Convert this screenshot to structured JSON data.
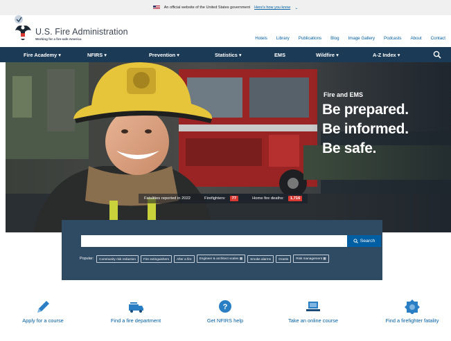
{
  "gov_banner": {
    "text": "An official website of the United States government",
    "link": "Here's how you know"
  },
  "header": {
    "title": "U.S. Fire Administration",
    "tagline": "Working for a fire-safe America",
    "utility_nav": [
      "Hotels",
      "Library",
      "Publications",
      "Blog",
      "Image Gallery",
      "Podcasts",
      "About",
      "Contact"
    ]
  },
  "main_nav": {
    "items": [
      {
        "label": "Fire Academy ▾"
      },
      {
        "label": "NFIRS ▾"
      },
      {
        "label": "Prevention ▾"
      },
      {
        "label": "Statistics ▾"
      },
      {
        "label": "EMS"
      },
      {
        "label": "Wildfire ▾"
      },
      {
        "label": "A-Z Index ▾"
      }
    ]
  },
  "hero": {
    "kicker": "Fire and EMS",
    "lines": [
      "Be prepared.",
      "Be informed.",
      "Be safe."
    ],
    "stats": {
      "label": "Fatalities reported in 2022",
      "firefighters_label": "Firefighters:",
      "firefighters_value": "77",
      "home_label": "Home fire deaths:",
      "home_value": "1,716"
    }
  },
  "search": {
    "placeholder": "",
    "button": "Search",
    "popular_label": "Popular:",
    "popular": [
      "Community risk reduction",
      "Fire extinguishers",
      "After a fire",
      "Engineer & architect scales",
      "Smoke alarms",
      "Grants",
      "Risk management"
    ]
  },
  "quick_links": [
    {
      "label": "Apply for a course",
      "icon": "pencil-icon"
    },
    {
      "label": "Find a fire department",
      "icon": "fire-truck-icon"
    },
    {
      "label": "Get NFIRS help",
      "icon": "question-icon"
    },
    {
      "label": "Take an online course",
      "icon": "laptop-icon"
    },
    {
      "label": "Find a firefighter fatality",
      "icon": "badge-icon"
    }
  ],
  "colors": {
    "nav_bg": "#1a3a56",
    "search_panel": "#2f4a63",
    "link_blue": "#005ea2",
    "accent_red": "#d83933"
  }
}
